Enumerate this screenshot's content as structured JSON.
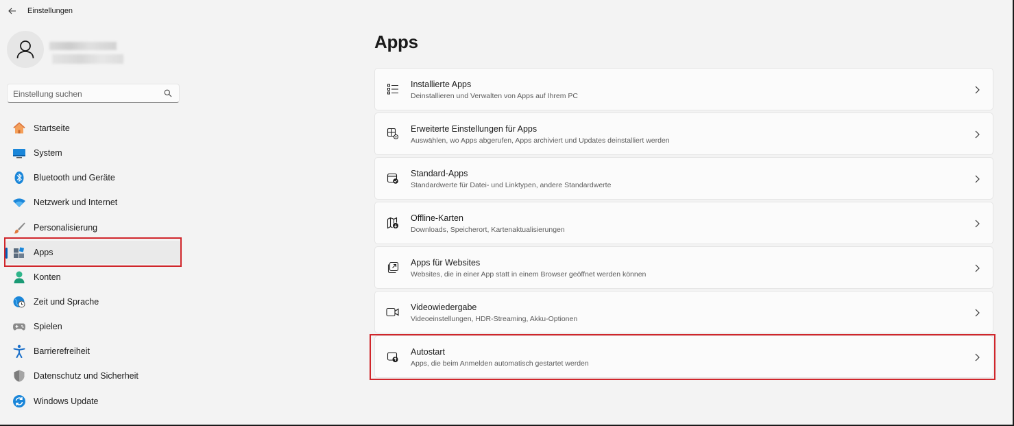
{
  "window": {
    "title": "Einstellungen"
  },
  "search": {
    "placeholder": "Einstellung suchen"
  },
  "sidebar": {
    "items": [
      {
        "label": "Startseite",
        "icon": "home-icon"
      },
      {
        "label": "System",
        "icon": "system-icon"
      },
      {
        "label": "Bluetooth und Geräte",
        "icon": "bluetooth-icon"
      },
      {
        "label": "Netzwerk und Internet",
        "icon": "wifi-icon"
      },
      {
        "label": "Personalisierung",
        "icon": "brush-icon"
      },
      {
        "label": "Apps",
        "icon": "apps-icon",
        "selected": true
      },
      {
        "label": "Konten",
        "icon": "account-icon"
      },
      {
        "label": "Zeit und Sprache",
        "icon": "clock-globe-icon"
      },
      {
        "label": "Spielen",
        "icon": "gamepad-icon"
      },
      {
        "label": "Barrierefreiheit",
        "icon": "accessibility-icon"
      },
      {
        "label": "Datenschutz und Sicherheit",
        "icon": "shield-icon"
      },
      {
        "label": "Windows Update",
        "icon": "update-icon"
      }
    ]
  },
  "main": {
    "title": "Apps",
    "cards": [
      {
        "title": "Installierte Apps",
        "subtitle": "Deinstallieren und Verwalten von Apps auf Ihrem PC",
        "icon": "list-icon"
      },
      {
        "title": "Erweiterte Einstellungen für Apps",
        "subtitle": "Auswählen, wo Apps abgerufen, Apps archiviert und Updates deinstalliert werden",
        "icon": "apps-settings-icon"
      },
      {
        "title": "Standard-Apps",
        "subtitle": "Standardwerte für Datei- und Linktypen, andere Standardwerte",
        "icon": "default-apps-icon"
      },
      {
        "title": "Offline-Karten",
        "subtitle": "Downloads, Speicherort, Kartenaktualisierungen",
        "icon": "map-download-icon"
      },
      {
        "title": "Apps für Websites",
        "subtitle": "Websites, die in einer App statt in einem Browser geöffnet werden können",
        "icon": "open-external-icon"
      },
      {
        "title": "Videowiedergabe",
        "subtitle": "Videoeinstellungen, HDR-Streaming, Akku-Optionen",
        "icon": "video-icon"
      },
      {
        "title": "Autostart",
        "subtitle": "Apps, die beim Anmelden automatisch gestartet werden",
        "icon": "startup-icon"
      }
    ]
  },
  "colors": {
    "accent": "#005fb8",
    "highlight": "#d0262b",
    "background": "#f3f3f3",
    "card": "#fbfbfb"
  }
}
